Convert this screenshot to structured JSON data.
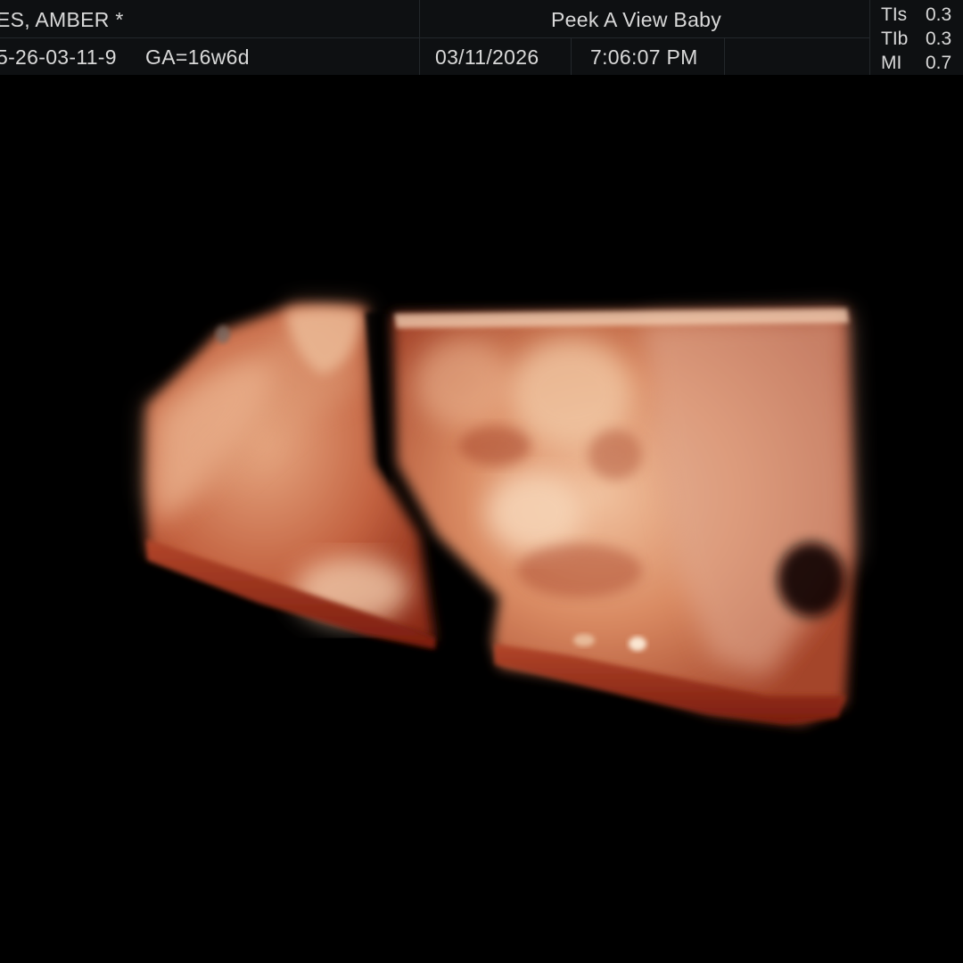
{
  "header": {
    "patient_name": "ES, AMBER  *",
    "patient_id": "5-26-03-11-9",
    "gestational_age": "GA=16w6d",
    "clinic_name": "Peek A View Baby",
    "date": "03/11/2026",
    "time": "7:06:07 PM"
  },
  "indices": [
    {
      "label": "TIs",
      "value": "0.3"
    },
    {
      "label": "TIb",
      "value": "0.3"
    },
    {
      "label": "MI",
      "value": "0.7"
    }
  ],
  "colors": {
    "background": "#000000",
    "header_bg": "#0e1012",
    "header_text": "#d9d9d9",
    "tissue_light": "#e8b08c",
    "tissue_mid": "#c9704a",
    "tissue_dark": "#8a2a14"
  }
}
